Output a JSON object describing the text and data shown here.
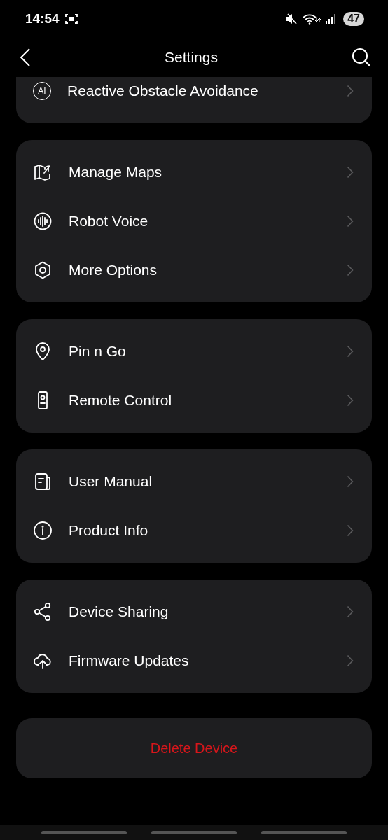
{
  "status_bar": {
    "time": "14:54",
    "battery": "47"
  },
  "header": {
    "title": "Settings"
  },
  "groups": [
    {
      "items": [
        {
          "label": "Reactive Obstacle Avoidance",
          "kind": "ai",
          "icon_text": "AI"
        }
      ]
    },
    {
      "items": [
        {
          "label": "Manage Maps",
          "kind": "map"
        },
        {
          "label": "Robot Voice",
          "kind": "voice"
        },
        {
          "label": "More Options",
          "kind": "options"
        }
      ]
    },
    {
      "items": [
        {
          "label": "Pin n Go",
          "kind": "pin"
        },
        {
          "label": "Remote Control",
          "kind": "remote"
        }
      ]
    },
    {
      "items": [
        {
          "label": "User Manual",
          "kind": "manual"
        },
        {
          "label": "Product Info",
          "kind": "info"
        }
      ]
    },
    {
      "items": [
        {
          "label": "Device Sharing",
          "kind": "share"
        },
        {
          "label": "Firmware Updates",
          "kind": "firmware"
        }
      ]
    }
  ],
  "delete_button": {
    "label": "Delete Device"
  }
}
